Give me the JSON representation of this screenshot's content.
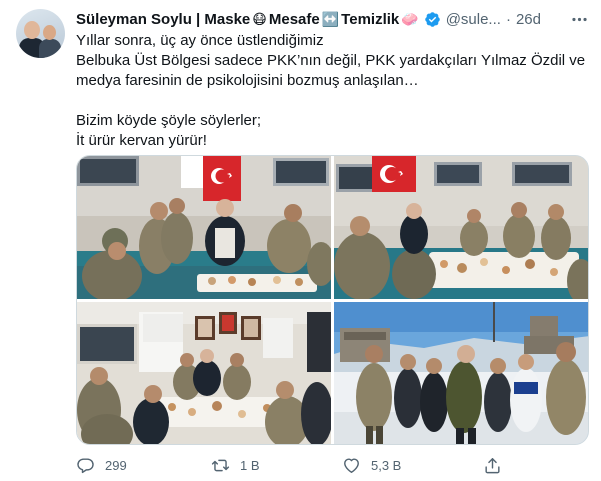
{
  "author": {
    "name_part1": "Süleyman Soylu | Maske",
    "emoji1": "😷",
    "name_part2": "Mesafe",
    "emoji2": "↔️",
    "name_part3": "Temizlik",
    "emoji3": "🧼",
    "handle": "@sule...",
    "separator": "·",
    "time": "26d"
  },
  "tweet": {
    "lines": [
      "Yıllar sonra, üç ay önce üstlendiğimiz",
      "Belbuka Üst Bölgesi sadece PKK’nın değil, PKK yardakçıları Yılmaz Özdil ve",
      "medya faresinin de psikolojisini bozmuş anlaşılan…",
      "Bizim köyde şöyle söylerler;",
      "İt ürür kervan yürür!"
    ]
  },
  "actions": {
    "replies": "299",
    "retweets": "1 B",
    "likes": "5,3 B"
  },
  "colors": {
    "text": "#0f1419",
    "secondary": "#536471",
    "verified": "#1d9bf0",
    "border": "#cfd9de"
  },
  "icons": {
    "verified": "verified-badge-icon",
    "more": "more-dots-icon",
    "reply": "reply-icon",
    "retweet": "retweet-icon",
    "like": "heart-icon",
    "share": "share-icon"
  }
}
